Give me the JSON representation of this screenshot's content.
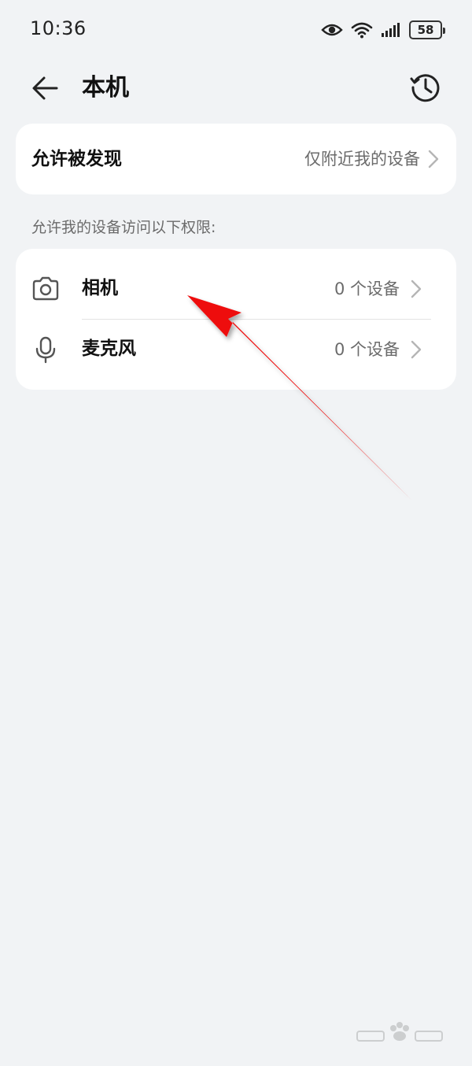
{
  "status_bar": {
    "time": "10:36",
    "battery_level": "58",
    "icons": [
      "eye-icon",
      "wifi-icon",
      "signal-icon",
      "battery-icon"
    ]
  },
  "header": {
    "title": "本机",
    "back_icon": "back-arrow-icon",
    "history_icon": "history-clock-icon"
  },
  "discover": {
    "label": "允许被发现",
    "value": "仅附近我的设备"
  },
  "section_caption": "允许我的设备访问以下权限:",
  "permissions": [
    {
      "icon": "camera-icon",
      "label": "相机",
      "value": "0 个设备"
    },
    {
      "icon": "microphone-icon",
      "label": "麦克风",
      "value": "0 个设备"
    }
  ],
  "annotation": {
    "color": "#ee1111"
  },
  "colors": {
    "background": "#f1f3f5",
    "card": "#ffffff",
    "secondary_text": "#6b6b6b"
  }
}
